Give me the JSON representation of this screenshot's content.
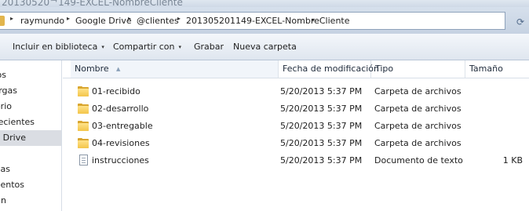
{
  "window": {
    "title": "20130520ᄏ149-EXCEL-NombreCliente"
  },
  "address": {
    "crumbs": [
      "raymundo",
      "Google Drive",
      "@clientes",
      "201305201149-EXCEL-NombreCliente"
    ]
  },
  "toolbar": {
    "include_library": "Incluir en biblioteca",
    "share_with": "Compartir con",
    "burn": "Grabar",
    "new_folder": "Nueva carpeta"
  },
  "nav": {
    "items": [
      "os",
      "rgas",
      "orio",
      "recientes",
      "e Drive",
      "",
      "as",
      "mentos",
      "n"
    ]
  },
  "columns": {
    "name": "Nombre",
    "modified": "Fecha de modificación",
    "type": "Tipo",
    "size": "Tamaño"
  },
  "files": [
    {
      "name": "01-recibido",
      "modified": "5/20/2013 5:37 PM",
      "type": "Carpeta de archivos",
      "size": "",
      "icon": "folder-icon"
    },
    {
      "name": "02-desarrollo",
      "modified": "5/20/2013 5:37 PM",
      "type": "Carpeta de archivos",
      "size": "",
      "icon": "folder-icon"
    },
    {
      "name": "03-entregable",
      "modified": "5/20/2013 5:37 PM",
      "type": "Carpeta de archivos",
      "size": "",
      "icon": "folder-icon"
    },
    {
      "name": "04-revisiones",
      "modified": "5/20/2013 5:37 PM",
      "type": "Carpeta de archivos",
      "size": "",
      "icon": "folder-icon"
    },
    {
      "name": "instrucciones",
      "modified": "5/20/2013 5:37 PM",
      "type": "Documento de texto",
      "size": "1 KB",
      "icon": "text-document-icon"
    }
  ],
  "colors": {
    "chrome_top": "#d6e0ec",
    "toolbar": "#e9eef5",
    "selected_nav": "#dadde3",
    "folder": "#f3c54a"
  }
}
